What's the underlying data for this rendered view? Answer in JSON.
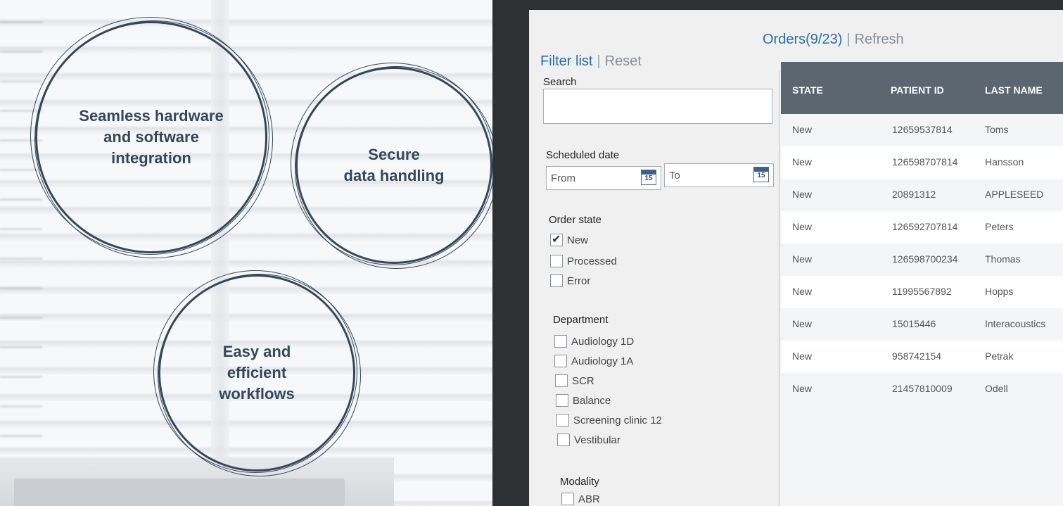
{
  "features": [
    {
      "line1": "Seamless hardware",
      "line2": "and software",
      "line3": "integration"
    },
    {
      "line1": "Secure",
      "line2": "data handling"
    },
    {
      "line1": "Easy and",
      "line2": "efficient",
      "line3": "workflows"
    }
  ],
  "filter": {
    "filter_list": "Filter list",
    "reset": "Reset",
    "search_label": "Search",
    "search_value": "",
    "scheduled_label": "Scheduled date",
    "from": "From",
    "to": "To",
    "calendar_day": "15",
    "order_state_label": "Order state",
    "order_states": [
      {
        "label": "New",
        "checked": true
      },
      {
        "label": "Processed",
        "checked": false
      },
      {
        "label": "Error",
        "checked": false
      }
    ],
    "department_label": "Department",
    "departments": [
      "Audiology 1D",
      "Audiology 1A",
      "SCR",
      "Balance",
      "Screening clinic 12",
      "Vestibular"
    ],
    "modality_label": "Modality",
    "modalities": [
      "ABR"
    ]
  },
  "orders": {
    "title": "Orders(9/23)",
    "refresh": "Refresh",
    "columns": [
      "STATE",
      "PATIENT ID",
      "LAST NAME"
    ],
    "rows": [
      [
        "New",
        "12659537814",
        "Toms"
      ],
      [
        "New",
        "126598707814",
        "Hansson"
      ],
      [
        "New",
        "20891312",
        "APPLESEED"
      ],
      [
        "New",
        "126592707814",
        "Peters"
      ],
      [
        "New",
        "126598700234",
        "Thomas"
      ],
      [
        "New",
        "11995567892",
        "Hopps"
      ],
      [
        "New",
        "15015446",
        "Interacoustics"
      ],
      [
        "New",
        "958742154",
        "Petrak"
      ],
      [
        "New",
        "21457810009",
        "Odell"
      ]
    ]
  }
}
